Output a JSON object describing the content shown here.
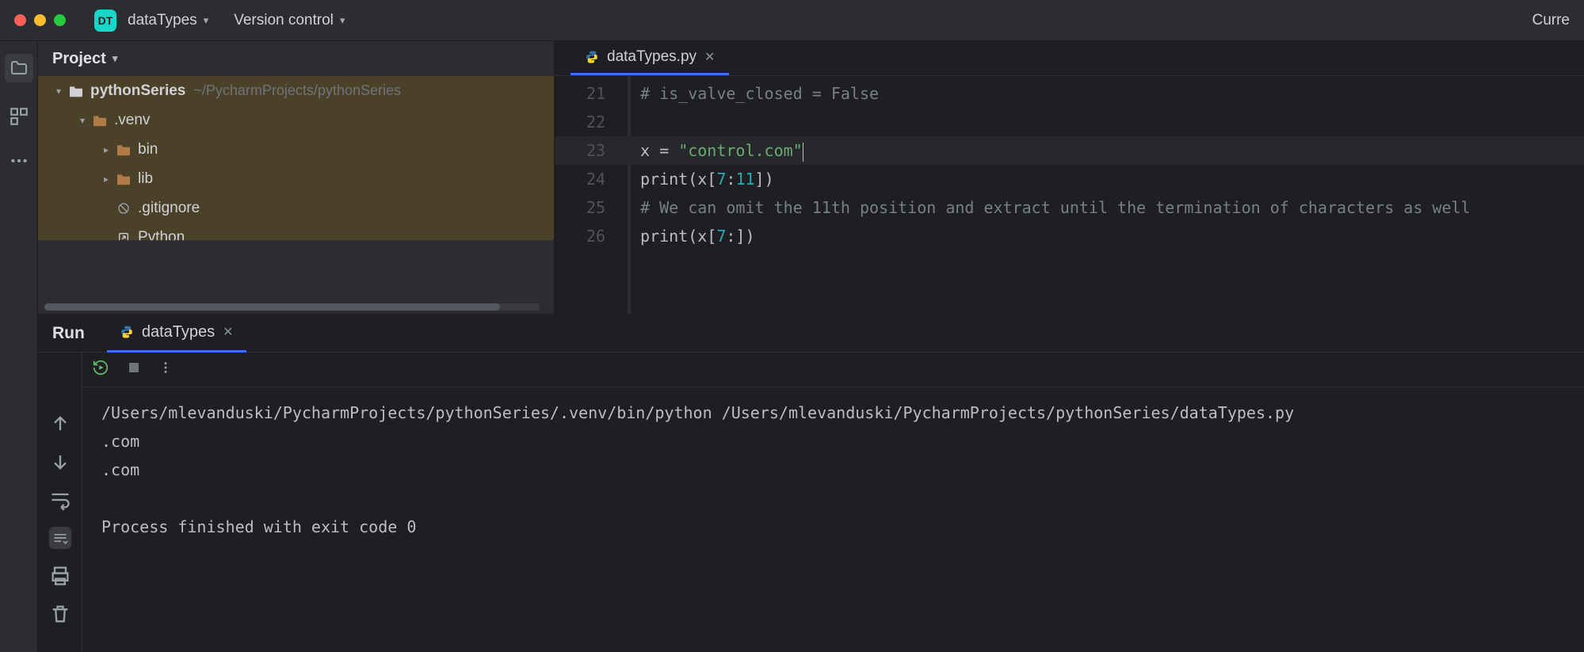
{
  "titlebar": {
    "badge": "DT",
    "project": "dataTypes",
    "vcs": "Version control",
    "right": "Curre"
  },
  "projectPanel": {
    "title": "Project",
    "root": {
      "name": "pythonSeries",
      "path": "~/PycharmProjects/pythonSeries"
    },
    "items": [
      {
        "name": ".venv",
        "indent": 1,
        "caret": "down",
        "folder": true
      },
      {
        "name": "bin",
        "indent": 2,
        "caret": "right",
        "folder": true
      },
      {
        "name": "lib",
        "indent": 2,
        "caret": "right",
        "folder": true
      },
      {
        "name": ".gitignore",
        "indent": 2,
        "caret": "none",
        "icon": "ignore"
      },
      {
        "name": "Python",
        "indent": 2,
        "caret": "none",
        "icon": "ext",
        "cut": true
      }
    ]
  },
  "editor": {
    "tab": {
      "label": "dataTypes.py"
    },
    "startLine": 21,
    "lines": [
      {
        "n": 21,
        "tokens": [
          {
            "t": "# is_valve_closed = False",
            "c": "c-cmt"
          }
        ]
      },
      {
        "n": 22,
        "tokens": []
      },
      {
        "n": 23,
        "tokens": [
          {
            "t": "x ",
            "c": "c-var"
          },
          {
            "t": "= ",
            "c": "c-var"
          },
          {
            "t": "\"control.com\"",
            "c": "c-str"
          }
        ],
        "caret": true
      },
      {
        "n": 24,
        "tokens": [
          {
            "t": "print",
            "c": "c-fn"
          },
          {
            "t": "(x[",
            "c": "c-var"
          },
          {
            "t": "7",
            "c": "c-num"
          },
          {
            "t": ":",
            "c": "c-var"
          },
          {
            "t": "11",
            "c": "c-num"
          },
          {
            "t": "])",
            "c": "c-var"
          }
        ]
      },
      {
        "n": 25,
        "tokens": [
          {
            "t": "# We can omit the 11th position and extract until the termination of characters as well",
            "c": "c-cmt"
          }
        ]
      },
      {
        "n": 26,
        "tokens": [
          {
            "t": "print",
            "c": "c-fn"
          },
          {
            "t": "(x[",
            "c": "c-var"
          },
          {
            "t": "7",
            "c": "c-num"
          },
          {
            "t": ":])",
            "c": "c-var"
          }
        ]
      }
    ]
  },
  "run": {
    "title": "Run",
    "tab": "dataTypes",
    "output": [
      "/Users/mlevanduski/PycharmProjects/pythonSeries/.venv/bin/python /Users/mlevanduski/PycharmProjects/pythonSeries/dataTypes.py",
      ".com",
      ".com",
      "",
      "Process finished with exit code 0"
    ]
  }
}
